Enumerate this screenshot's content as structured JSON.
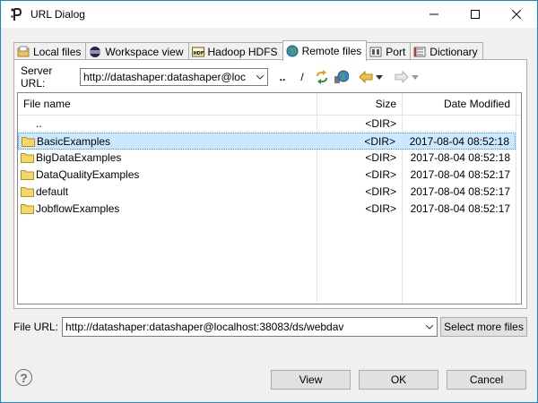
{
  "window": {
    "title": "URL Dialog"
  },
  "tabs": [
    {
      "label": "Local files",
      "icon": "local-files-icon",
      "active": false
    },
    {
      "label": "Workspace view",
      "icon": "eclipse-workspace-icon",
      "active": false
    },
    {
      "label": "Hadoop HDFS",
      "icon": "hdfs-icon",
      "active": false
    },
    {
      "label": "Remote files",
      "icon": "globe-icon",
      "active": true
    },
    {
      "label": "Port",
      "icon": "port-icon",
      "active": false
    },
    {
      "label": "Dictionary",
      "icon": "dictionary-icon",
      "active": false
    }
  ],
  "server": {
    "label": "Server URL:",
    "value": "http://datashaper:datashaper@loc",
    "parent_dir_label": "..",
    "root_label": "/"
  },
  "table": {
    "columns": {
      "name": "File name",
      "size": "Size",
      "date": "Date Modified"
    },
    "rows": [
      {
        "name": "..",
        "size": "<DIR>",
        "date": "",
        "folder": false,
        "selected": false
      },
      {
        "name": "BasicExamples",
        "size": "<DIR>",
        "date": "2017-08-04 08:52:18",
        "folder": true,
        "selected": true
      },
      {
        "name": "BigDataExamples",
        "size": "<DIR>",
        "date": "2017-08-04 08:52:18",
        "folder": true,
        "selected": false
      },
      {
        "name": "DataQualityExamples",
        "size": "<DIR>",
        "date": "2017-08-04 08:52:17",
        "folder": true,
        "selected": false
      },
      {
        "name": "default",
        "size": "<DIR>",
        "date": "2017-08-04 08:52:17",
        "folder": true,
        "selected": false
      },
      {
        "name": "JobflowExamples",
        "size": "<DIR>",
        "date": "2017-08-04 08:52:17",
        "folder": true,
        "selected": false
      }
    ]
  },
  "file_url": {
    "label": "File URL:",
    "value": "http://datashaper:datashaper@localhost:38083/ds/webdav",
    "select_more_label": "Select more files"
  },
  "buttons": {
    "view": "View",
    "ok": "OK",
    "cancel": "Cancel"
  },
  "colors": {
    "accent": "#1883d7",
    "selection": "#cce8ff",
    "folder": "#f5d769"
  }
}
